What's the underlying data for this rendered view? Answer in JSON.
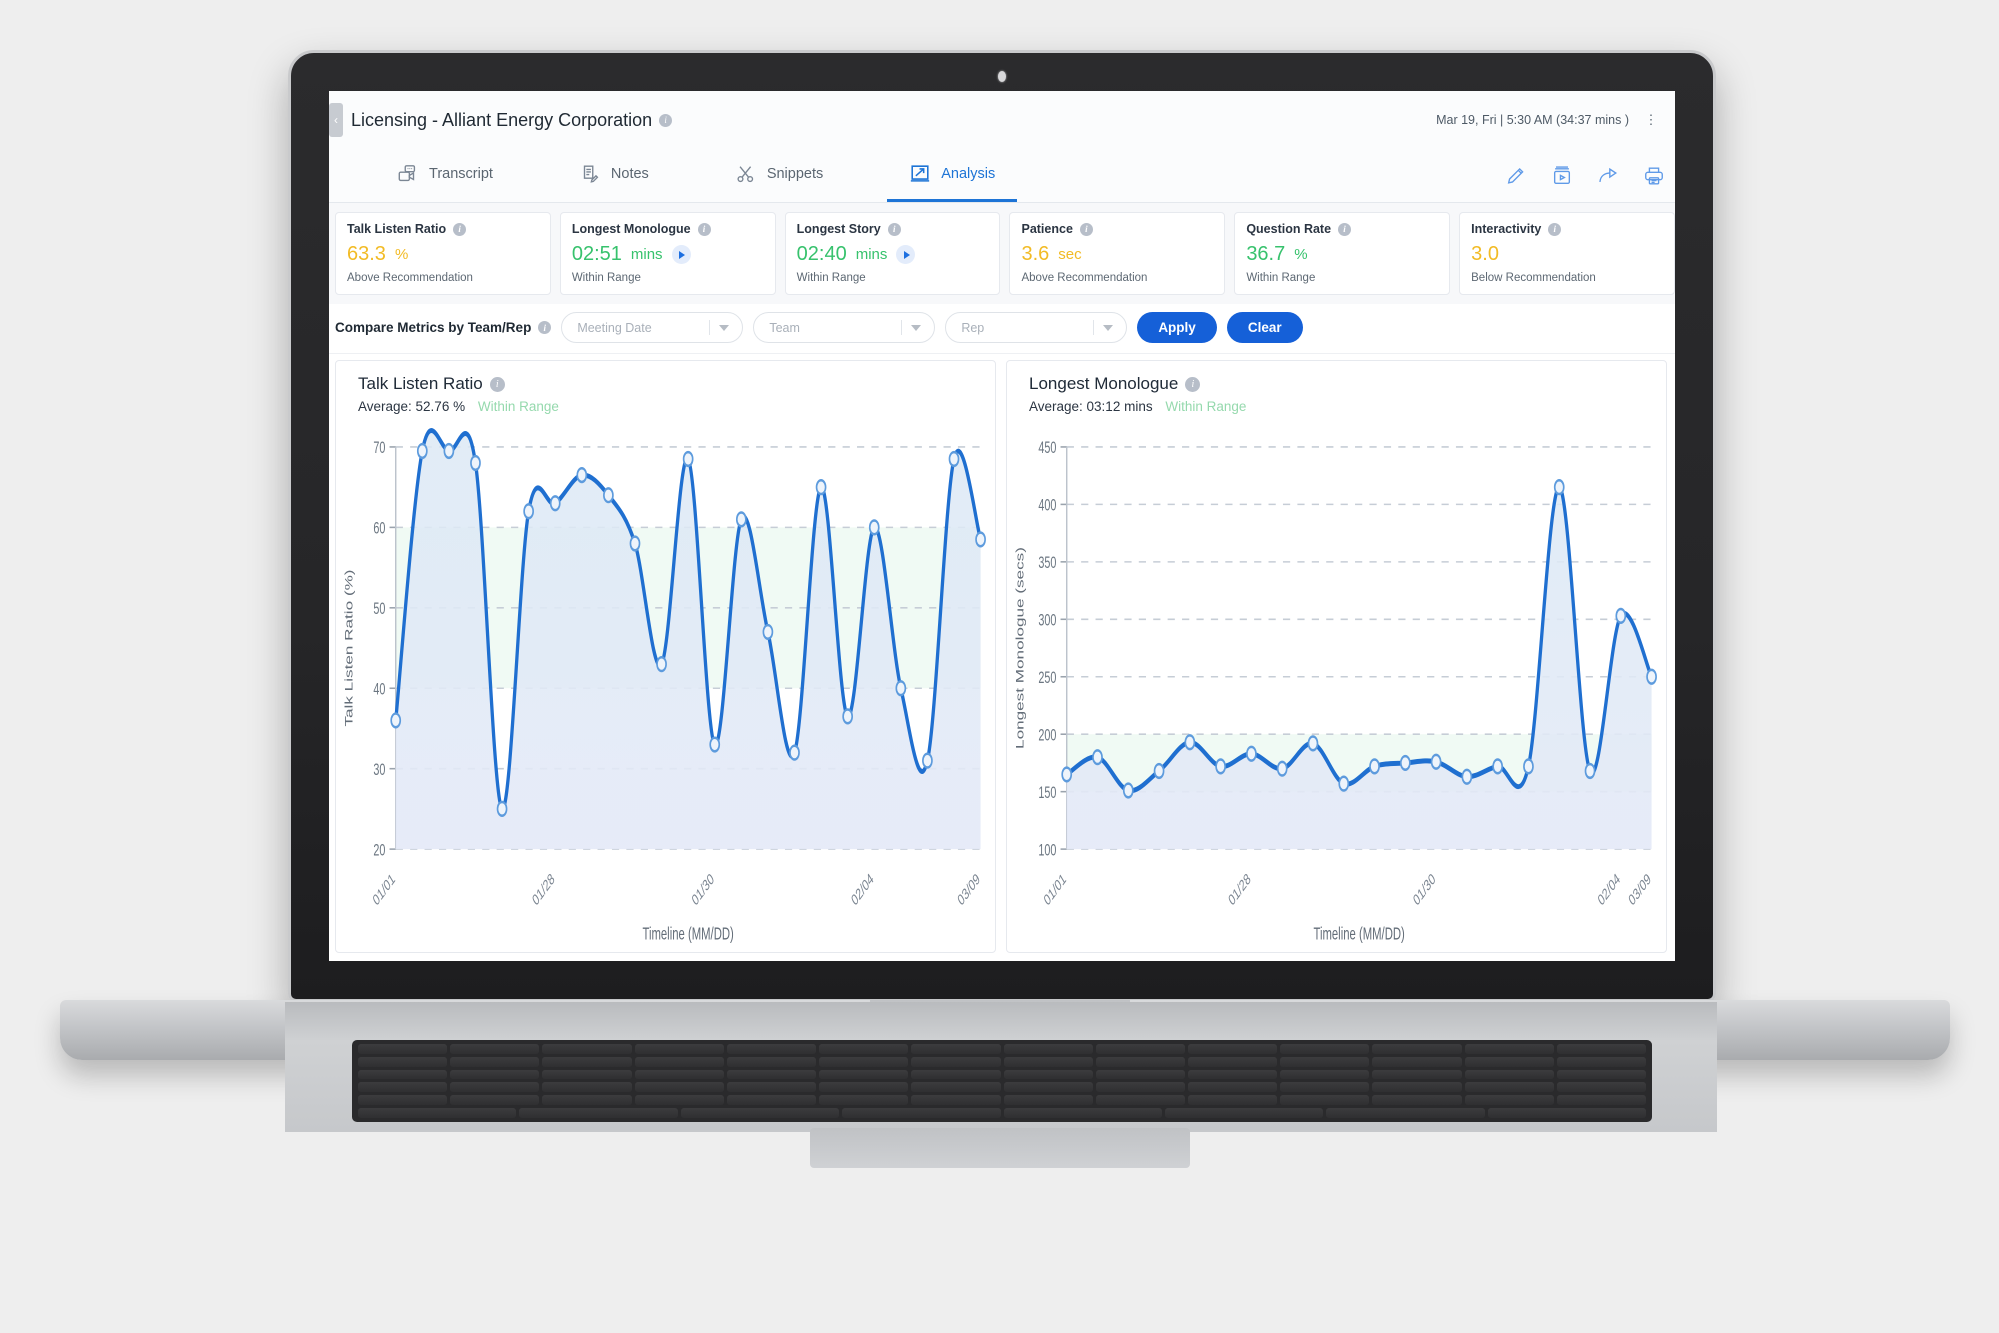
{
  "header": {
    "back_label": "‹",
    "meeting_title": "Licensing - Alliant Energy Corporation",
    "info_glyph": "i",
    "meeting_date": "Mar 19, Fri | 5:30 AM (34:37 mins )",
    "kebab_glyph": "⋮"
  },
  "tabs": [
    {
      "label": "Transcript",
      "icon": "transcript-icon",
      "active": false
    },
    {
      "label": "Notes",
      "icon": "notes-icon",
      "active": false
    },
    {
      "label": "Snippets",
      "icon": "snippets-icon",
      "active": false
    },
    {
      "label": "Analysis",
      "icon": "analysis-icon",
      "active": true
    }
  ],
  "toolbar": {
    "icons": [
      "edit-pencil-icon",
      "video-archive-icon",
      "share-arrow-icon",
      "print-icon"
    ]
  },
  "metrics": [
    {
      "title": "Talk Listen Ratio",
      "value": "63.3",
      "unit": "%",
      "status": "Above Recommendation",
      "tone": "amber",
      "play": false
    },
    {
      "title": "Longest Monologue",
      "value": "02:51",
      "unit": "mins",
      "status": "Within Range",
      "tone": "green",
      "play": true
    },
    {
      "title": "Longest Story",
      "value": "02:40",
      "unit": "mins",
      "status": "Within Range",
      "tone": "green",
      "play": true
    },
    {
      "title": "Patience",
      "value": "3.6",
      "unit": "sec",
      "status": "Above Recommendation",
      "tone": "amber",
      "play": false
    },
    {
      "title": "Question Rate",
      "value": "36.7",
      "unit": "%",
      "status": "Within Range",
      "tone": "green",
      "play": false
    },
    {
      "title": "Interactivity",
      "value": "3.0",
      "unit": "",
      "status": "Below Recommendation",
      "tone": "amber",
      "play": false
    }
  ],
  "filters": {
    "label": "Compare Metrics by Team/Rep",
    "selects": [
      {
        "name": "meeting-date",
        "placeholder": "Meeting Date",
        "value": ""
      },
      {
        "name": "team",
        "placeholder": "Team",
        "value": ""
      },
      {
        "name": "rep",
        "placeholder": "Rep",
        "value": ""
      }
    ],
    "apply_label": "Apply",
    "clear_label": "Clear"
  },
  "chart_data": [
    {
      "type": "line",
      "name": "talk-listen-ratio",
      "title": "Talk Listen Ratio",
      "average_label": "Average: 52.76 %",
      "status": "Within Range",
      "xlabel": "Timeline (MM/DD)",
      "ylabel": "Talk Listen Ratio (%)",
      "ylim": [
        20,
        70
      ],
      "yticks": [
        20,
        30,
        40,
        50,
        60,
        70
      ],
      "xticks": [
        "01/01",
        "01/28",
        "01/30",
        "02/04",
        "03/09"
      ],
      "xtick_indices": [
        0,
        6,
        12,
        18,
        24
      ],
      "band": {
        "low": 40,
        "high": 60
      },
      "grid": true,
      "values": [
        36,
        69.5,
        69.5,
        68,
        25,
        62,
        63,
        66.5,
        64,
        58,
        43,
        68.5,
        33,
        61,
        47,
        32,
        65,
        36.5,
        60,
        40,
        31,
        68.5,
        58.5
      ]
    },
    {
      "type": "line",
      "name": "longest-monologue",
      "title": "Longest Monologue",
      "average_label": "Average: 03:12 mins",
      "status": "Within Range",
      "xlabel": "Timeline (MM/DD)",
      "ylabel": "Longest Monologue (secs)",
      "ylim": [
        100,
        450
      ],
      "yticks": [
        100,
        150,
        200,
        250,
        300,
        350,
        400,
        450
      ],
      "xticks": [
        "01/01",
        "01/28",
        "01/30",
        "02/04",
        "03/09"
      ],
      "xtick_indices": [
        0,
        6,
        12,
        18,
        24
      ],
      "band": {
        "low": 150,
        "high": 200
      },
      "grid": true,
      "values": [
        165,
        180,
        151,
        168,
        193,
        172,
        183,
        170,
        192,
        157,
        172,
        175,
        176,
        163,
        172,
        172,
        415,
        168,
        303,
        250
      ]
    }
  ]
}
